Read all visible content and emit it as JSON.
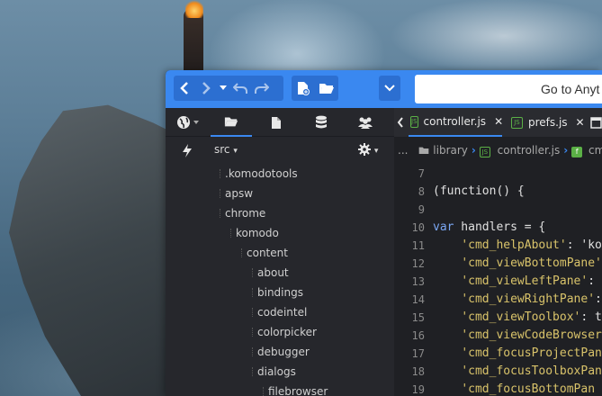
{
  "toolbar": {
    "goto_text": "Go to Anyt",
    "buttons": [
      "back",
      "forward",
      "history-dropdown",
      "undo",
      "redo",
      "new-file",
      "open-folder",
      "more-dropdown"
    ]
  },
  "left_pane": {
    "tabs": [
      "places",
      "files",
      "database",
      "collaboration"
    ],
    "places_root": "src",
    "tree": [
      {
        "label": ".komodotools",
        "depth": 0
      },
      {
        "label": "apsw",
        "depth": 0
      },
      {
        "label": "chrome",
        "depth": 0
      },
      {
        "label": "komodo",
        "depth": 1
      },
      {
        "label": "content",
        "depth": 2
      },
      {
        "label": "about",
        "depth": 3
      },
      {
        "label": "bindings",
        "depth": 3
      },
      {
        "label": "codeintel",
        "depth": 3
      },
      {
        "label": "colorpicker",
        "depth": 3
      },
      {
        "label": "debugger",
        "depth": 3
      },
      {
        "label": "dialogs",
        "depth": 3
      },
      {
        "label": "filebrowser",
        "depth": 4
      }
    ]
  },
  "editor": {
    "tabs": [
      {
        "label": "controller.js",
        "active": true
      },
      {
        "label": "prefs.js",
        "active": false
      }
    ],
    "breadcrumb": {
      "ellipsis": "...",
      "items": [
        "library",
        "controller.js",
        "cmc"
      ]
    },
    "lines": [
      {
        "n": "7",
        "text": ""
      },
      {
        "n": "8",
        "text": "(function() {"
      },
      {
        "n": "9",
        "text": ""
      },
      {
        "n": "10",
        "kw": "var",
        "text": " handlers = {"
      },
      {
        "n": "11",
        "str": "'cmd_helpAbout'",
        "text": ": 'ko"
      },
      {
        "n": "12",
        "str": "'cmd_viewBottomPane'",
        "text": ""
      },
      {
        "n": "13",
        "str": "'cmd_viewLeftPane'",
        "text": ":"
      },
      {
        "n": "14",
        "str": "'cmd_viewRightPane'",
        "text": ":"
      },
      {
        "n": "15",
        "str": "'cmd_viewToolbox'",
        "text": ": t"
      },
      {
        "n": "16",
        "str": "'cmd_viewCodeBrowser'",
        "text": ""
      },
      {
        "n": "17",
        "str": "'cmd_focusProjectPan",
        "text": ""
      },
      {
        "n": "18",
        "str": "'cmd_focusToolboxPan",
        "text": ""
      },
      {
        "n": "19",
        "str": "'cmd_focusBottomPan",
        "text": ""
      }
    ]
  },
  "colors": {
    "accent": "#3a88f0",
    "toolbar_group": "#2c6fd1",
    "pane_bg": "#26272c",
    "editor_bg": "#1f2024",
    "keyword": "#7aa6f2",
    "string": "#d9c36a",
    "js_badge": "#5bb046"
  }
}
